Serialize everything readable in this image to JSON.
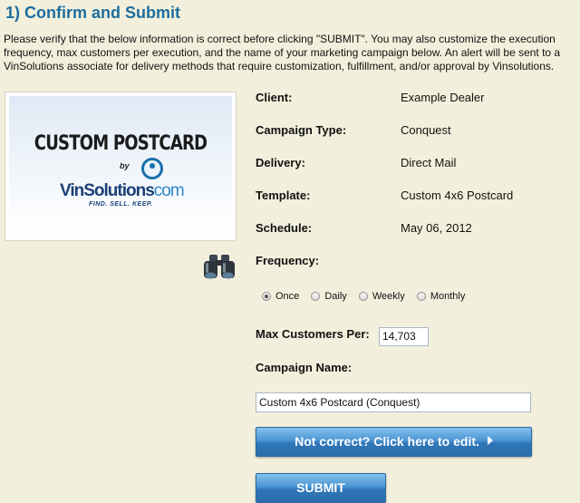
{
  "page": {
    "heading": "1) Confirm and Submit",
    "intro": "Please verify that the below information is correct before clicking \"SUBMIT\". You may also customize the execution frequency, max customers per execution, and the name of your marketing campaign below. An alert will be sent to a VinSolutions associate for delivery methods that require customization, fulfillment, and/or approval by Vinsolutions."
  },
  "preview": {
    "title": "CUSTOM POSTCARD",
    "by": "by",
    "brand_main": "VinSolutions",
    "brand_suffix": "com",
    "tagline": "FIND. SELL. KEEP."
  },
  "details": {
    "client_label": "Client:",
    "client_value": "Example Dealer",
    "campaign_type_label": "Campaign Type:",
    "campaign_type_value": "Conquest",
    "delivery_label": "Delivery:",
    "delivery_value": "Direct Mail",
    "template_label": "Template:",
    "template_value": "Custom 4x6 Postcard",
    "schedule_label": "Schedule:",
    "schedule_value": "May 06, 2012",
    "frequency_label": "Frequency:",
    "max_customers_label": "Max Customers Per:",
    "campaign_name_label": "Campaign Name:"
  },
  "frequency": {
    "options": [
      "Once",
      "Daily",
      "Weekly",
      "Monthly"
    ],
    "selected": "Once"
  },
  "inputs": {
    "max_customers_value": "14,703",
    "campaign_name_value": "Custom 4x6 Postcard (Conquest)"
  },
  "buttons": {
    "edit_label": "Not correct? Click here to edit.",
    "submit_label": "SUBMIT"
  },
  "icons": {
    "preview_icon": "binoculars-icon"
  },
  "colors": {
    "background": "#f2f0dc",
    "heading": "#1d6d9e",
    "button": "#3a82c2"
  }
}
